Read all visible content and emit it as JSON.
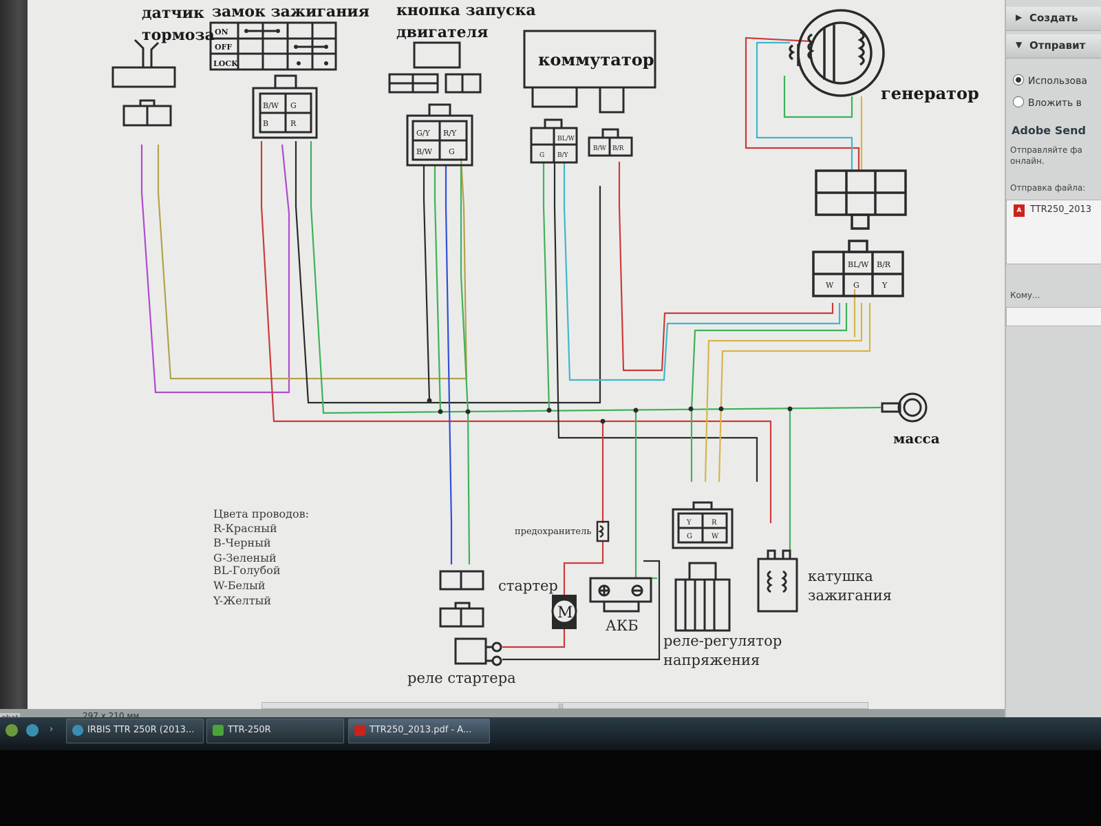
{
  "diagram": {
    "labels": {
      "brake_sensor_l1": "датчик",
      "brake_sensor_l2": "тормоза",
      "ignition_lock": "замок зажигания",
      "start_button_l1": "кнопка запуска",
      "start_button_l2": "двигателя",
      "commutator": "коммутатор",
      "generator": "генератор",
      "ground": "масса",
      "fuse": "предохранитель",
      "starter": "стартер",
      "battery": "АКБ",
      "starter_relay": "реле стартера",
      "regulator_l1": "реле-регулятор",
      "regulator_l2": "напряжения",
      "ignition_coil_l1": "катушка",
      "ignition_coil_l2": "зажигания",
      "motor_symbol": "M"
    },
    "ignition_switch_rows": [
      "ON",
      "OFF",
      "LOCK"
    ],
    "ignition_connector": {
      "row1": [
        "B/W",
        "G"
      ],
      "row2": [
        "B",
        "R"
      ]
    },
    "start_connector": {
      "row1": [
        "G/Y",
        "R/Y"
      ],
      "row2": [
        "B/W",
        "G"
      ]
    },
    "commutator_connector_a": {
      "row1": [
        "",
        "BL/W"
      ],
      "row2": [
        "G",
        "B/Y"
      ]
    },
    "commutator_connector_b": [
      "B/W",
      "B/R"
    ],
    "generator_connector": {
      "row1": [
        "",
        "BL/W",
        "B/R"
      ],
      "row2": [
        "W",
        "G",
        "Y"
      ]
    },
    "regulator_connector": {
      "row1": [
        "Y",
        "R"
      ],
      "row2": [
        "G",
        "W"
      ]
    },
    "legend": {
      "title": "Цвета проводов:",
      "items": [
        "R-Красный",
        "B-Черный",
        "G-Зеленый",
        "BL-Голубой",
        "W-Белый",
        "Y-Желтый"
      ]
    },
    "colors": {
      "red": "#cc3a3a",
      "black": "#2a2a2a",
      "green": "#3fb15a",
      "blue": "#2f4fd6",
      "cyan": "#3fb7c8",
      "yellow": "#d7b44a",
      "magenta": "#b04ad0",
      "olive": "#b3a24a"
    }
  },
  "status_bar": {
    "page_size": "297 x 210 мм",
    "acrobat_tab": "obat"
  },
  "right_panel": {
    "create_label": "Создать",
    "send_label": "Отправит",
    "radio_use": "Использова",
    "radio_attach": "Вложить в",
    "adobe_send_title": "Adobe Send",
    "adobe_send_desc_l1": "Отправляйте фа",
    "adobe_send_desc_l2": "онлайн.",
    "file_send_label": "Отправка файла:",
    "file_name": "TTR250_2013",
    "to_label": "Кому..."
  },
  "taskbar": {
    "items": [
      {
        "label": "IRBIS TTR 250R (2013..."
      },
      {
        "label": "TTR-250R"
      },
      {
        "label": "TTR250_2013.pdf - A..."
      }
    ]
  }
}
